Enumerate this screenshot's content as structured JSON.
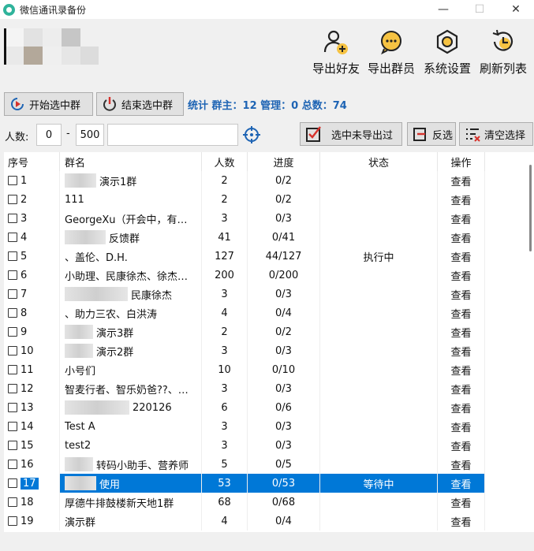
{
  "window": {
    "title": "微信通讯录备份",
    "minimize": "—",
    "maximize": "☐",
    "close": "✕"
  },
  "toolbar": {
    "export_friends": "导出好友",
    "export_members": "导出群员",
    "settings": "系统设置",
    "refresh": "刷新列表"
  },
  "actions": {
    "start_selected": "开始选中群",
    "stop_selected": "结束选中群",
    "stats": "统计 群主：12 管理：0 总数：74"
  },
  "filter": {
    "people_label": "人数:",
    "min": "0",
    "dash": "-",
    "max": "500",
    "search_value": "",
    "select_unexported": "选中未导出过",
    "invert": "反选",
    "clear": "清空选择"
  },
  "table": {
    "columns": [
      "序号",
      "群名",
      "人数",
      "进度",
      "状态",
      "操作"
    ],
    "rows": [
      {
        "no": "1",
        "name": "演示1群",
        "blur": 40,
        "count": "2",
        "progress": "0/2",
        "status": "",
        "action": "查看"
      },
      {
        "no": "2",
        "name": "111",
        "blur": 0,
        "count": "2",
        "progress": "0/2",
        "status": "",
        "action": "查看"
      },
      {
        "no": "3",
        "name": "GeorgeXu（开会中，有…",
        "blur": 0,
        "count": "3",
        "progress": "0/3",
        "status": "",
        "action": "查看"
      },
      {
        "no": "4",
        "name": "反馈群",
        "blur": 52,
        "count": "41",
        "progress": "0/41",
        "status": "",
        "action": "查看"
      },
      {
        "no": "5",
        "name": "、盖伦、D.H.",
        "blur": 0,
        "count": "127",
        "progress": "44/127",
        "status": "执行中",
        "action": "查看"
      },
      {
        "no": "6",
        "name": "小助理、民康徐杰、徐杰…",
        "blur": 0,
        "count": "200",
        "progress": "0/200",
        "status": "",
        "action": "查看"
      },
      {
        "no": "7",
        "name": "民康徐杰",
        "blur": 80,
        "count": "3",
        "progress": "0/3",
        "status": "",
        "action": "查看"
      },
      {
        "no": "8",
        "name": "、助力三农、白洪涛",
        "blur": 0,
        "count": "4",
        "progress": "0/4",
        "status": "",
        "action": "查看"
      },
      {
        "no": "9",
        "name": "演示3群",
        "blur": 36,
        "count": "2",
        "progress": "0/2",
        "status": "",
        "action": "查看"
      },
      {
        "no": "10",
        "name": "演示2群",
        "blur": 36,
        "count": "3",
        "progress": "0/3",
        "status": "",
        "action": "查看"
      },
      {
        "no": "11",
        "name": "小号们",
        "blur": 0,
        "count": "10",
        "progress": "0/10",
        "status": "",
        "action": "查看"
      },
      {
        "no": "12",
        "name": "智麦行者、智乐奶爸??、…",
        "blur": 0,
        "count": "3",
        "progress": "0/3",
        "status": "",
        "action": "查看"
      },
      {
        "no": "13",
        "name": "220126",
        "blur": 82,
        "count": "6",
        "progress": "0/6",
        "status": "",
        "action": "查看"
      },
      {
        "no": "14",
        "name": "Test A",
        "blur": 0,
        "count": "3",
        "progress": "0/3",
        "status": "",
        "action": "查看"
      },
      {
        "no": "15",
        "name": "test2",
        "blur": 0,
        "count": "3",
        "progress": "0/3",
        "status": "",
        "action": "查看"
      },
      {
        "no": "16",
        "name": "转码小助手、营养师",
        "blur": 36,
        "count": "5",
        "progress": "0/5",
        "status": "",
        "action": "查看"
      },
      {
        "no": "17",
        "name": "使用",
        "blur": 40,
        "count": "53",
        "progress": "0/53",
        "status": "等待中",
        "action": "查看",
        "selected": true
      },
      {
        "no": "18",
        "name": "厚德牛排鼓楼新天地1群",
        "blur": 0,
        "count": "68",
        "progress": "0/68",
        "status": "",
        "action": "查看"
      },
      {
        "no": "19",
        "name": "演示群",
        "blur": 0,
        "count": "4",
        "progress": "0/4",
        "status": "",
        "action": "查看"
      }
    ]
  }
}
